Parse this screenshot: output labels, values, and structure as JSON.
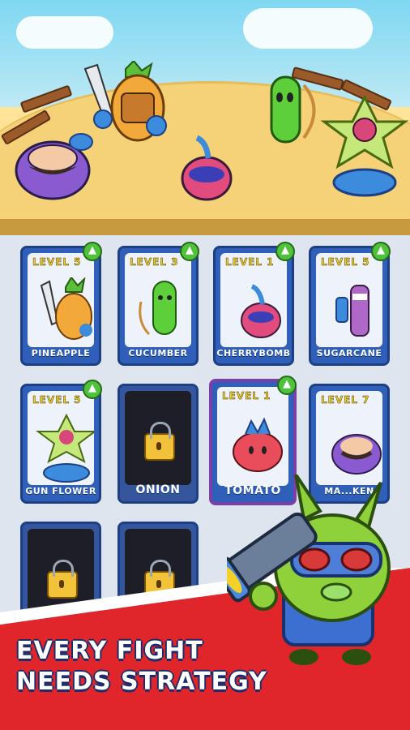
{
  "cards": [
    {
      "level": "LEVEL 5",
      "name": "PINEAPPLE",
      "locked": false,
      "upgrade": true
    },
    {
      "level": "LEVEL 3",
      "name": "CUCUMBER",
      "locked": false,
      "upgrade": true
    },
    {
      "level": "LEVEL 1",
      "name": "CHERRYBOMB",
      "locked": false,
      "upgrade": true
    },
    {
      "level": "LEVEL 5",
      "name": "SUGARCANE",
      "locked": false,
      "upgrade": true
    },
    {
      "level": "LEVEL 5",
      "name": "GUN FLOWER",
      "locked": false,
      "upgrade": true
    },
    {
      "level": "",
      "name": "ONION",
      "locked": true,
      "upgrade": false
    },
    {
      "level": "LEVEL 1",
      "name": "TOMATO",
      "locked": false,
      "upgrade": true
    },
    {
      "level": "LEVEL 7",
      "name": "MA...KEN",
      "locked": false,
      "upgrade": false
    }
  ],
  "tagline": {
    "line1": "EVERY FIGHT",
    "line2": "NEEDS STRATEGY"
  },
  "colors": {
    "card_blue": "#2f5fb8",
    "level_yellow": "#f4d02a",
    "upgrade_green": "#4fc23b",
    "banner_red": "#e0262b",
    "mascot_green": "#8fd13a"
  }
}
